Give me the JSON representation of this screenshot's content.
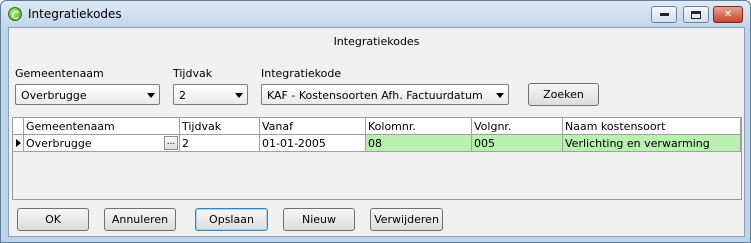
{
  "window": {
    "title": "Integratiekodes"
  },
  "form": {
    "title": "Integratiekodes"
  },
  "filters": {
    "gemeentenaam": {
      "label": "Gemeentenaam",
      "value": "Overbrugge"
    },
    "tijdvak": {
      "label": "Tijdvak",
      "value": "2"
    },
    "integratiekode": {
      "label": "Integratiekode",
      "value": "KAF - Kostensoorten Afh.  Factuurdatum"
    },
    "search_label": "Zoeken"
  },
  "grid": {
    "columns": [
      "Gemeentenaam",
      "Tijdvak",
      "Vanaf",
      "Kolomnr.",
      "Volgnr.",
      "Naam kostensoort"
    ],
    "rows": [
      {
        "gemeentenaam": "Overbrugge",
        "tijdvak": "2",
        "vanaf": "01-01-2005",
        "kolomnr": "08",
        "volgnr": "005",
        "naam": "Verlichting en verwarming"
      }
    ],
    "ellipsis": "..."
  },
  "buttons": {
    "ok": "OK",
    "cancel": "Annuleren",
    "save": "Opslaan",
    "new": "Nieuw",
    "delete": "Verwijderen"
  },
  "colors": {
    "highlight_cell": "#b8f0b0",
    "titlebar": "#c4d6ea"
  }
}
